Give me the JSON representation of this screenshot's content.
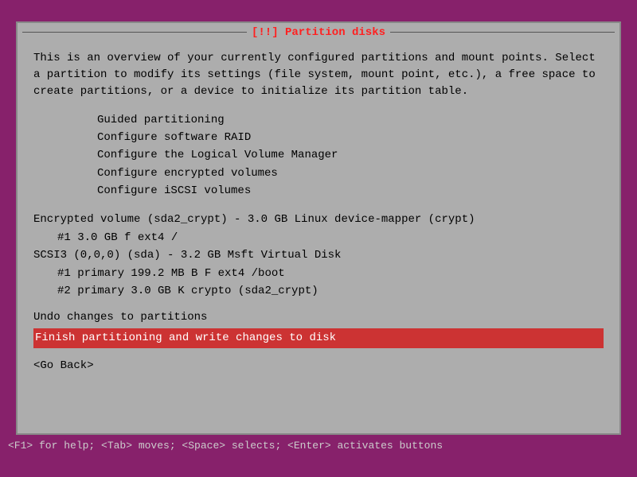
{
  "title": "[!!] Partition disks",
  "description": "This is an overview of your currently configured partitions and mount points. Select a partition to modify its settings (file system, mount point, etc.), a free space to create partitions, or a device to initialize its partition table.",
  "menu": {
    "items": [
      "Guided partitioning",
      "Configure software RAID",
      "Configure the Logical Volume Manager",
      "Configure encrypted volumes",
      "Configure iSCSI volumes"
    ]
  },
  "partitions": {
    "encrypted_volume": "Encrypted volume (sda2_crypt) - 3.0 GB Linux device-mapper (crypt)",
    "enc_entry1": "        #1        3.0 GB     f  ext4       /",
    "scsi_header": "SCSI3 (0,0,0) (sda) - 3.2 GB Msft Virtual Disk",
    "scsi_entry1": "        #1  primary   199.2 MB  B  F  ext4      /boot",
    "scsi_entry2": "        #2  primary     3.0 GB     K  crypto    (sda2_crypt)"
  },
  "actions": {
    "undo": "Undo changes to partitions",
    "finish": "Finish partitioning and write changes to disk"
  },
  "go_back": "<Go Back>",
  "status_bar": "<F1> for help; <Tab> moves; <Space> selects; <Enter> activates buttons"
}
